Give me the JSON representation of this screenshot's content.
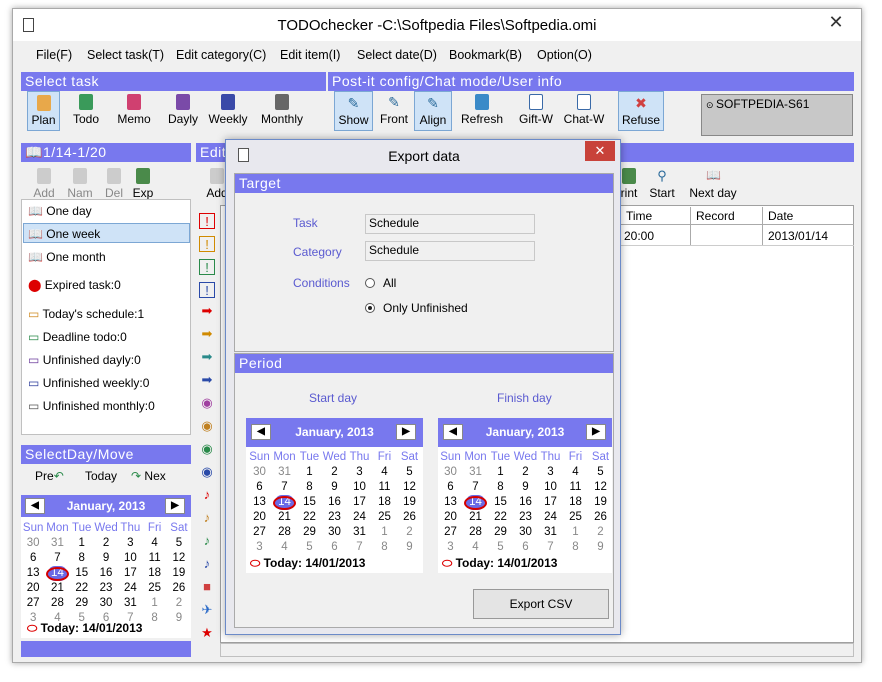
{
  "window": {
    "title": "TODOchecker -C:\\Softpedia Files\\Softpedia.omi",
    "watermark": "SOFTPEDIA"
  },
  "menu": [
    "File(F)",
    "Select task(T)",
    "Edit category(C)",
    "Edit item(I)",
    "Select date(D)",
    "Bookmark(B)",
    "Option(O)"
  ],
  "bars": {
    "select_task": "Select task",
    "postit": "Post-it config/Chat mode/User info",
    "date_range": "1/14-1/20",
    "edit": "Edit",
    "selectday": "SelectDay/Move"
  },
  "toolbar": {
    "left": [
      "Plan",
      "Todo",
      "Memo",
      "Dayly",
      "Weekly",
      "Monthly"
    ],
    "mid": [
      "Show",
      "Front",
      "Align"
    ],
    "right": [
      "Refresh",
      "Gift-W",
      "Chat-W",
      "Refuse"
    ],
    "user": "SOFTPEDIA-S61"
  },
  "left_toolbar": [
    "Add",
    "Nam",
    "Del",
    "Exp"
  ],
  "left_list": {
    "range": [
      "One day",
      "One week",
      "One month"
    ],
    "expired": "Expired task:0",
    "stats": [
      "Today's schedule:1",
      "Deadline todo:0",
      "Unfinished dayly:0",
      "Unfinished weekly:0",
      "Unfinished monthly:0"
    ]
  },
  "nav": {
    "prev": "Pre",
    "today": "Today",
    "next": "Nex"
  },
  "main_toolbar": {
    "add": "Add",
    "print": "rint",
    "start": "Start",
    "next_day": "Next day"
  },
  "table": {
    "headers": [
      "Time",
      "Record",
      "Date"
    ],
    "row": {
      "time": "20:00",
      "record": "",
      "date": "2013/01/14"
    }
  },
  "calendar": {
    "month": "January, 2013",
    "weekdays": [
      "Sun",
      "Mon",
      "Tue",
      "Wed",
      "Thu",
      "Fri",
      "Sat"
    ],
    "days": [
      [
        "30",
        "31",
        "1",
        "2",
        "3",
        "4",
        "5"
      ],
      [
        "6",
        "7",
        "8",
        "9",
        "10",
        "11",
        "12"
      ],
      [
        "13",
        "14",
        "15",
        "16",
        "17",
        "18",
        "19"
      ],
      [
        "20",
        "21",
        "22",
        "23",
        "24",
        "25",
        "26"
      ],
      [
        "27",
        "28",
        "29",
        "30",
        "31",
        "1",
        "2"
      ],
      [
        "3",
        "4",
        "5",
        "6",
        "7",
        "8",
        "9"
      ]
    ],
    "today_label": "Today: 14/01/2013"
  },
  "dialog": {
    "title": "Export data",
    "target_header": "Target",
    "task_label": "Task",
    "task_value": "Schedule",
    "category_label": "Category",
    "category_value": "Schedule",
    "conditions_label": "Conditions",
    "opt_all": "All",
    "opt_unfinished": "Only Unfinished",
    "period_header": "Period",
    "start_label": "Start day",
    "finish_label": "Finish day",
    "export_button": "Export CSV"
  },
  "colors": {
    "accent": "#7878ee",
    "selected": "#cfe3f7"
  }
}
